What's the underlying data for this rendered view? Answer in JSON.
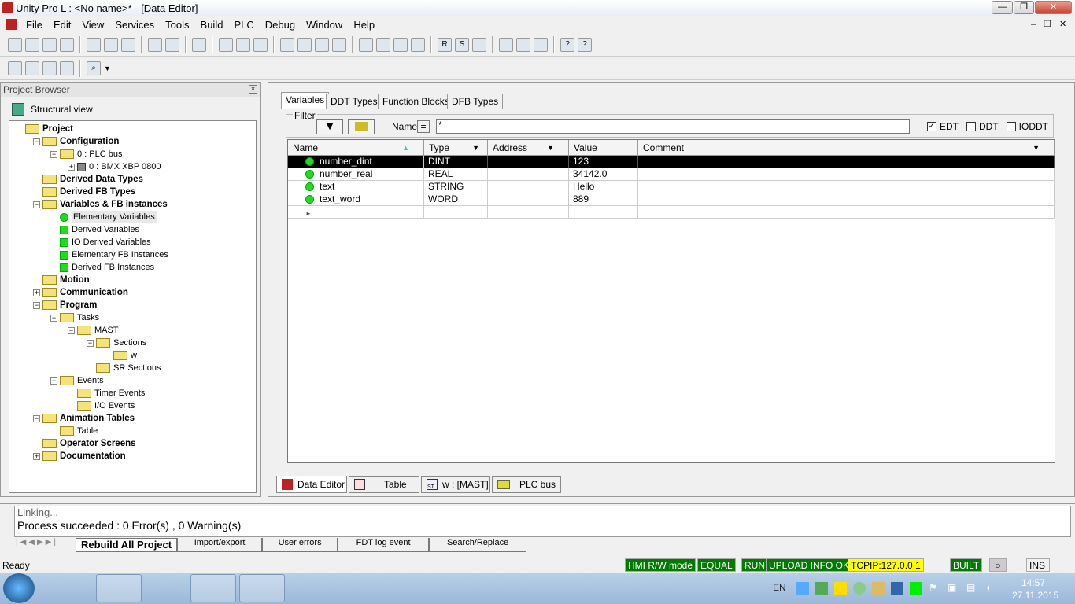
{
  "window": {
    "title": "Unity Pro L : <No name>* - [Data Editor]"
  },
  "menu": [
    "File",
    "Edit",
    "View",
    "Services",
    "Tools",
    "Build",
    "PLC",
    "Debug",
    "Window",
    "Help"
  ],
  "project_browser": {
    "title": "Project Browser",
    "view": "Structural view",
    "tree": [
      {
        "label": "Project",
        "bold": true,
        "level": 0
      },
      {
        "label": "Configuration",
        "bold": true,
        "level": 1
      },
      {
        "label": "0 : PLC bus",
        "level": 2
      },
      {
        "label": "0 : BMX XBP 0800",
        "level": 3
      },
      {
        "label": "Derived Data Types",
        "bold": true,
        "level": 1
      },
      {
        "label": "Derived FB Types",
        "bold": true,
        "level": 1
      },
      {
        "label": "Variables & FB instances",
        "bold": true,
        "level": 1
      },
      {
        "label": "Elementary Variables",
        "level": 2,
        "selected": true
      },
      {
        "label": "Derived Variables",
        "level": 2
      },
      {
        "label": "IO Derived Variables",
        "level": 2
      },
      {
        "label": "Elementary FB Instances",
        "level": 2
      },
      {
        "label": "Derived FB Instances",
        "level": 2
      },
      {
        "label": "Motion",
        "bold": true,
        "level": 1
      },
      {
        "label": "Communication",
        "bold": true,
        "level": 1
      },
      {
        "label": "Program",
        "bold": true,
        "level": 1
      },
      {
        "label": "Tasks",
        "level": 2
      },
      {
        "label": "MAST",
        "level": 3
      },
      {
        "label": "Sections",
        "level": 4
      },
      {
        "label": "w",
        "level": 5
      },
      {
        "label": "SR Sections",
        "level": 4
      },
      {
        "label": "Events",
        "level": 2
      },
      {
        "label": "Timer Events",
        "level": 3
      },
      {
        "label": "I/O Events",
        "level": 3
      },
      {
        "label": "Animation Tables",
        "bold": true,
        "level": 1
      },
      {
        "label": "Table",
        "level": 2
      },
      {
        "label": "Operator Screens",
        "bold": true,
        "level": 1
      },
      {
        "label": "Documentation",
        "bold": true,
        "level": 1
      }
    ]
  },
  "editor": {
    "tabs": [
      "Variables",
      "DDT Types",
      "Function Blocks",
      "DFB Types"
    ],
    "filter": {
      "label": "Filter",
      "name_label": "Name",
      "eq": "=",
      "value": "*",
      "checks": [
        {
          "label": "EDT",
          "checked": true
        },
        {
          "label": "DDT",
          "checked": false
        },
        {
          "label": "IODDT",
          "checked": false
        }
      ]
    },
    "columns": [
      "Name",
      "Type",
      "Address",
      "Value",
      "Comment"
    ],
    "rows": [
      {
        "name": "number_dint",
        "type": "DINT",
        "address": "",
        "value": "123",
        "comment": ""
      },
      {
        "name": "number_real",
        "type": "REAL",
        "address": "",
        "value": "34142.0",
        "comment": ""
      },
      {
        "name": "text",
        "type": "STRING",
        "address": "",
        "value": "Hello",
        "comment": ""
      },
      {
        "name": "text_word",
        "type": "WORD",
        "address": "",
        "value": "889",
        "comment": ""
      }
    ],
    "bottom_tabs": [
      "Data Editor",
      "Table",
      "w : [MAST]",
      "PLC bus"
    ]
  },
  "output": {
    "lines": [
      "Linking...",
      "Process succeeded  : 0 Error(s) , 0 Warning(s)"
    ],
    "tabs": [
      "Rebuild All Project",
      "Import/export",
      "User errors",
      "FDT log event",
      "Search/Replace"
    ]
  },
  "status": {
    "ready": "Ready",
    "items": [
      "HMI R/W mode",
      "EQUAL",
      "RUN",
      "UPLOAD INFO OK",
      "TCPIP:127.0.0.1",
      "BUILT",
      "INS"
    ]
  },
  "taskbar": {
    "lang": "EN",
    "time": "14:57",
    "date": "27.11.2015"
  }
}
